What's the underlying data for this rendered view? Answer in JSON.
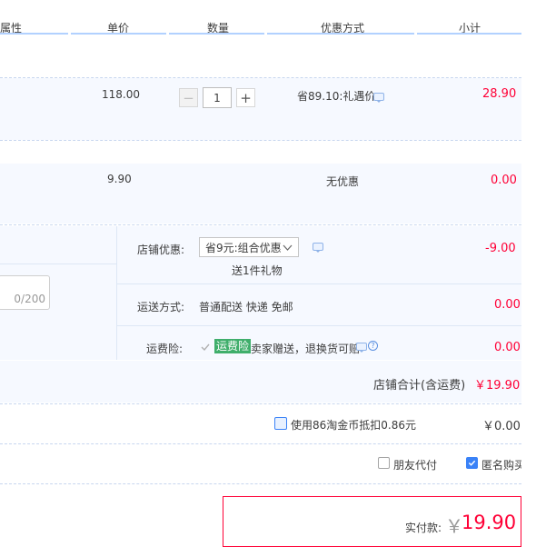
{
  "header": {
    "col_attr": "属性",
    "col_price": "单价",
    "col_qty": "数量",
    "col_discount": "优惠方式",
    "col_subtotal": "小计"
  },
  "item1": {
    "unit_price": "118.00",
    "quantity": "1",
    "discount": "省89.10:礼遇价",
    "subtotal": "28.90",
    "minus_symbol": "−",
    "plus_symbol": "+"
  },
  "item2": {
    "unit_price": "9.90",
    "discount": "无优惠",
    "subtotal": "0.00"
  },
  "shop": {
    "message_counter": "0/200",
    "discount_label": "店铺优惠:",
    "discount_selected": "省9元:组合优惠",
    "gift": "送1件礼物",
    "discount_amount": "-9.00",
    "shipping_label": "运送方式:",
    "shipping_value": "普通配送 快递 免邮",
    "shipping_amount": "0.00",
    "insurance_label": "运费险:",
    "insurance_badge": "运费险",
    "insurance_desc": "卖家赠送，退换货可赔",
    "insurance_amount": "0.00",
    "total_label": "店铺合计(含运费)",
    "total_value": "￥19.90"
  },
  "coins": {
    "label": "使用86淘金币抵扣0.86元",
    "amount": "￥0.00"
  },
  "options": {
    "friend_pay": "朋友代付",
    "anonymous": "匿名购买"
  },
  "payment": {
    "label": "实付款:",
    "currency": "￥",
    "amount": "19.90"
  },
  "colors": {
    "accent_red": "#ff0036",
    "header_line": "#b2d1ff",
    "row_bg": "#f6f9ff",
    "checkbox_blue": "#3a82f7",
    "badge_green": "#3fae6b"
  }
}
